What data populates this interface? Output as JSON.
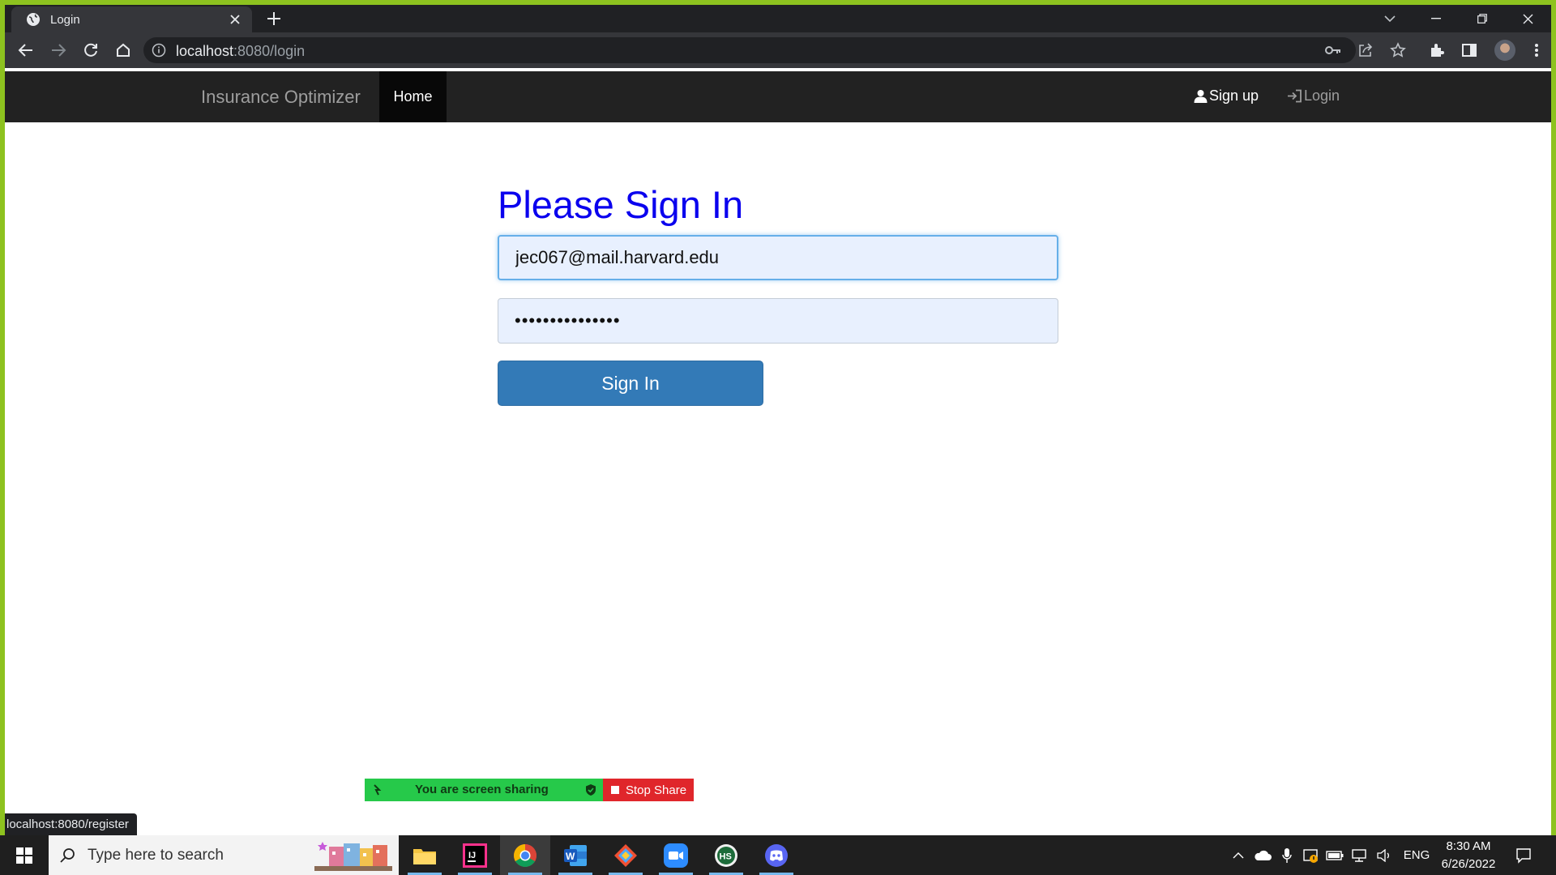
{
  "browser": {
    "tab_title": "Login",
    "url_host": "localhost",
    "url_rest": ":8080/login"
  },
  "navbar": {
    "brand": "Insurance Optimizer",
    "home": "Home",
    "signup": "Sign up",
    "login": "Login"
  },
  "form": {
    "heading": "Please Sign In",
    "email_value": "jec067@mail.harvard.edu",
    "password_value": "•••••••••••••••",
    "submit_label": "Sign In"
  },
  "share_bar": {
    "status": "You are screen sharing",
    "stop_label": "Stop Share"
  },
  "status_bar": {
    "link": "localhost:8080/register"
  },
  "taskbar": {
    "search_placeholder": "Type here to search",
    "language": "ENG",
    "time": "8:30 AM",
    "date": "6/26/2022",
    "apps": [
      "file-explorer",
      "intellij-idea",
      "google-chrome",
      "microsoft-word",
      "git-kraken",
      "zoom",
      "hs-app",
      "discord"
    ]
  },
  "colors": {
    "window_border": "#8dc21f",
    "navbar_bg": "#222222",
    "heading": "#0a00ee",
    "primary_button": "#337ab7",
    "autofill_bg": "#e8f0fe",
    "share_green": "#26c94a",
    "share_red": "#e0262b"
  }
}
